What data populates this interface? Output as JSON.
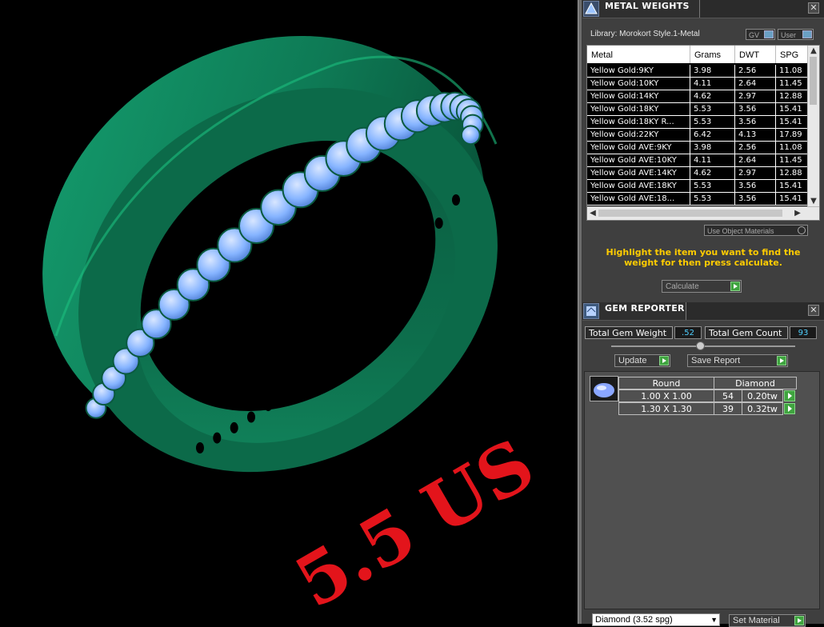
{
  "viewport": {
    "size_label": "5.5 US",
    "colors": {
      "metal": "#0e7a55",
      "gem": "#7fb2ff",
      "label": "#e3141b",
      "background": "#000000"
    }
  },
  "metal_weights": {
    "title": "METAL WEIGHTS",
    "library": "Library: Morokort Style.1-Metal",
    "toggle_gv": "GV",
    "toggle_user": "User",
    "columns": [
      "Metal",
      "Grams",
      "DWT",
      "SPG"
    ],
    "rows": [
      [
        "Yellow Gold:9KY",
        "3.98",
        "2.56",
        "11.08"
      ],
      [
        "Yellow Gold:10KY",
        "4.11",
        "2.64",
        "11.45"
      ],
      [
        "Yellow Gold:14KY",
        "4.62",
        "2.97",
        "12.88"
      ],
      [
        "Yellow Gold:18KY",
        "5.53",
        "3.56",
        "15.41"
      ],
      [
        "Yellow Gold:18KY R...",
        "5.53",
        "3.56",
        "15.41"
      ],
      [
        "Yellow Gold:22KY",
        "6.42",
        "4.13",
        "17.89"
      ],
      [
        "Yellow Gold AVE:9KY",
        "3.98",
        "2.56",
        "11.08"
      ],
      [
        "Yellow Gold AVE:10KY",
        "4.11",
        "2.64",
        "11.45"
      ],
      [
        "Yellow Gold AVE:14KY",
        "4.62",
        "2.97",
        "12.88"
      ],
      [
        "Yellow Gold AVE:18KY",
        "5.53",
        "3.56",
        "15.41"
      ],
      [
        "Yellow Gold AVE:18...",
        "5.53",
        "3.56",
        "15.41"
      ]
    ],
    "use_object_materials": "Use Object Materials",
    "hint": "Highlight the item you want to find the weight for then press calculate.",
    "calculate": "Calculate"
  },
  "gem_reporter": {
    "title": "GEM REPORTER",
    "total_weight_label": "Total Gem Weight",
    "total_weight_value": ".52",
    "total_count_label": "Total Gem Count",
    "total_count_value": "93",
    "update": "Update",
    "save_report": "Save Report",
    "group": {
      "shape": "Round",
      "material": "Diamond"
    },
    "gems": [
      {
        "size": "1.00 X 1.00",
        "count": "54",
        "weight": "0.20tw"
      },
      {
        "size": "1.30 X 1.30",
        "count": "39",
        "weight": "0.32tw"
      }
    ],
    "material_select": "Diamond    (3.52 spg)",
    "set_material": "Set Material"
  }
}
